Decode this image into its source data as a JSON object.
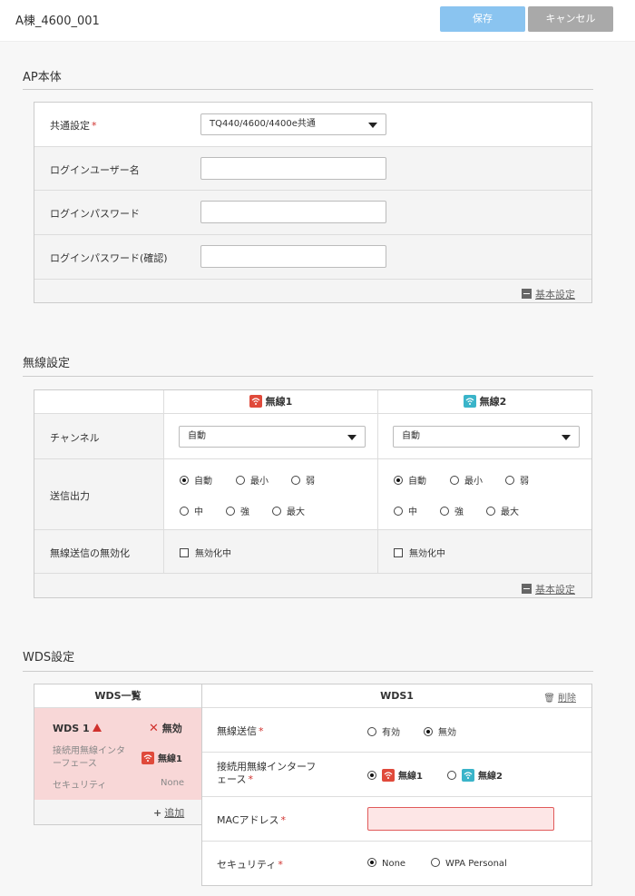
{
  "header": {
    "title": "A棟_4600_001",
    "save_label": "保存",
    "cancel_label": "キャンセル"
  },
  "ap": {
    "section_title": "AP本体",
    "common_label": "共通設定",
    "common_required": "*",
    "common_value": "TQ440/4600/4400e共通",
    "login_user_label": "ログインユーザー名",
    "login_user_value": "",
    "login_pw_label": "ログインパスワード",
    "login_pw_value": "",
    "login_pw_confirm_label": "ログインパスワード(確認)",
    "login_pw_confirm_value": "",
    "basic_link": "基本設定"
  },
  "wireless": {
    "section_title": "無線設定",
    "radio1_label": "無線1",
    "radio2_label": "無線2",
    "channel_label": "チャンネル",
    "channel1_value": "自動",
    "channel2_value": "自動",
    "power_label": "送信出力",
    "power_options": [
      "自動",
      "最小",
      "弱",
      "中",
      "強",
      "最大"
    ],
    "power1_selected": "自動",
    "power2_selected": "自動",
    "disable_label": "無線送信の無効化",
    "disable_option": "無効化中",
    "disable1_checked": false,
    "disable2_checked": false,
    "basic_link": "基本設定"
  },
  "wds": {
    "section_title": "WDS設定",
    "list_header": "WDS一覧",
    "item_name": "WDS 1",
    "item_status": "無効",
    "item_iface_label": "接続用無線インターフェース",
    "item_iface_value": "無線1",
    "item_security_label": "セキュリティ",
    "item_security_value": "None",
    "add_label": "追加",
    "detail_header": "WDS1",
    "delete_label": "削除",
    "tx_label": "無線送信",
    "tx_options": [
      "有効",
      "無効"
    ],
    "tx_selected": "無効",
    "iface_label": "接続用無線インターフェース",
    "iface_options": [
      "無線1",
      "無線2"
    ],
    "iface_selected": "無線1",
    "mac_label": "MACアドレス",
    "mac_value": "",
    "security_label": "セキュリティ",
    "security_options": [
      "None",
      "WPA Personal"
    ],
    "security_selected": "None",
    "required_mark": "*"
  },
  "colors": {
    "save": "#8ac4f0",
    "cancel": "#a9a9a9",
    "radio1": "#e04a3b",
    "radio2": "#3ab4c9",
    "error_bg": "#f8d7d7"
  }
}
